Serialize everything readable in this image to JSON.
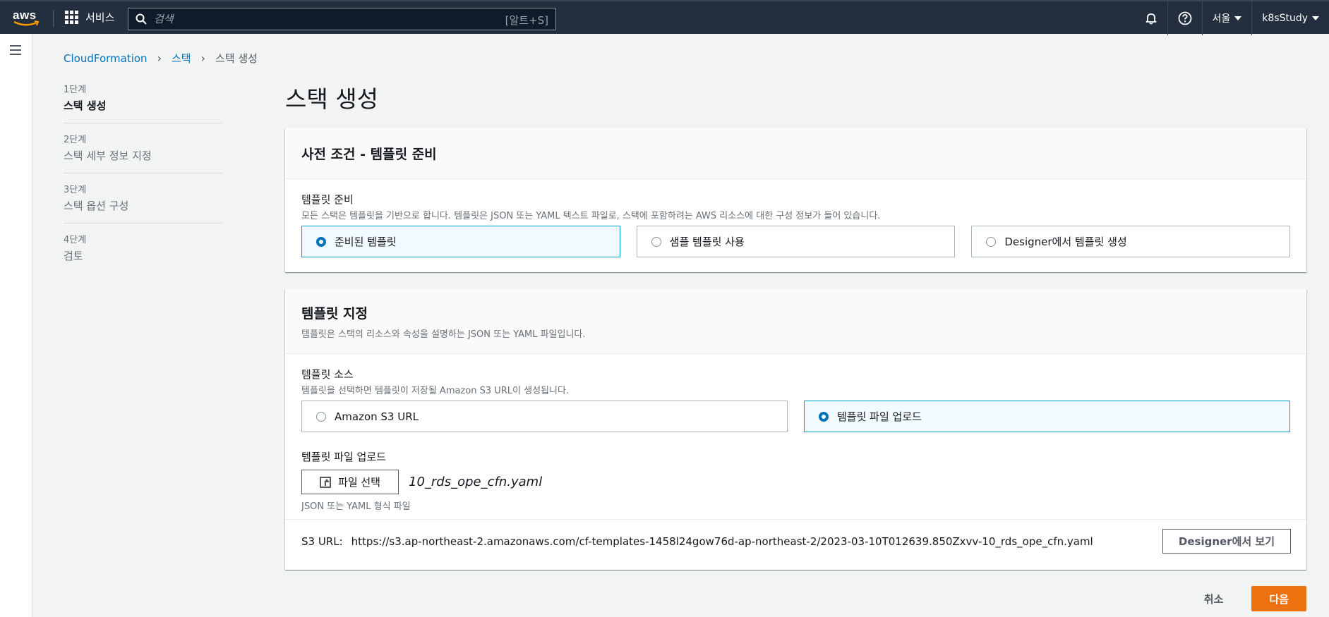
{
  "topnav": {
    "logo_text": "aws",
    "services_label": "서비스",
    "search_placeholder": "검색",
    "search_shortcut": "[알트+S]",
    "region": "서울",
    "account": "k8sStudy"
  },
  "breadcrumb": {
    "items": [
      "CloudFormation",
      "스택"
    ],
    "current": "스택 생성"
  },
  "steps": [
    {
      "num": "1단계",
      "title": "스택 생성"
    },
    {
      "num": "2단계",
      "title": "스택 세부 정보 지정"
    },
    {
      "num": "3단계",
      "title": "스택 옵션 구성"
    },
    {
      "num": "4단계",
      "title": "검토"
    }
  ],
  "page_title": "스택 생성",
  "prereq": {
    "title": "사전 조건 - 템플릿 준비",
    "field_label": "템플릿 준비",
    "field_desc": "모든 스택은 템플릿을 기반으로 합니다. 템플릿은 JSON 또는 YAML 텍스트 파일로, 스택에 포함하려는 AWS 리소스에 대한 구성 정보가 들어 있습니다.",
    "options": [
      "준비된 템플릿",
      "샘플 템플릿 사용",
      "Designer에서 템플릿 생성"
    ],
    "selected": 0
  },
  "specify": {
    "title": "템플릿 지정",
    "desc": "템플릿은 스택의 리소스와 속성을 설명하는 JSON 또는 YAML 파일입니다.",
    "source_label": "템플릿 소스",
    "source_desc": "템플릿을 선택하면 템플릿이 저장될 Amazon S3 URL이 생성됩니다.",
    "options": [
      "Amazon S3 URL",
      "템플릿 파일 업로드"
    ],
    "selected": 1,
    "upload_label": "템플릿 파일 업로드",
    "choose_file_label": "파일 선택",
    "filename": "10_rds_ope_cfn.yaml",
    "upload_hint": "JSON 또는 YAML 형식 파일",
    "s3_label": "S3 URL:",
    "s3_url": "https://s3.ap-northeast-2.amazonaws.com/cf-templates-1458l24gow76d-ap-northeast-2/2023-03-10T012639.850Zxvv-10_rds_ope_cfn.yaml",
    "designer_button": "Designer에서 보기"
  },
  "actions": {
    "cancel": "취소",
    "next": "다음"
  },
  "colors": {
    "nav_bg": "#232f3e",
    "accent": "#0073bb",
    "primary": "#ec7211",
    "selected_border": "#00a1c9"
  }
}
